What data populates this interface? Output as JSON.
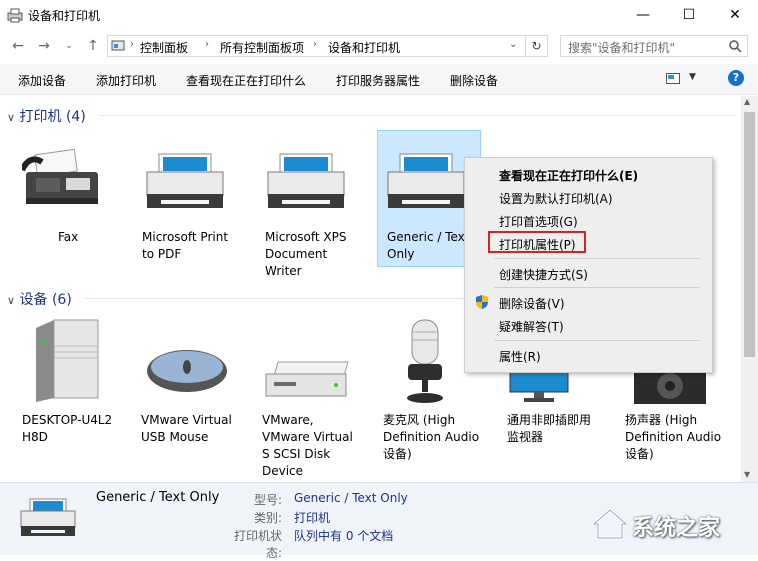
{
  "window": {
    "title": "设备和打印机"
  },
  "address": {
    "crumbs": [
      "控制面板",
      "所有控制面板项",
      "设备和打印机"
    ],
    "search_placeholder": "搜索\"设备和打印机\""
  },
  "toolbar": {
    "items": [
      "添加设备",
      "添加打印机",
      "查看现在正在打印什么",
      "打印服务器属性",
      "删除设备"
    ]
  },
  "printers": {
    "header": "打印机 (4)",
    "items": [
      {
        "lines": [
          "Fax"
        ]
      },
      {
        "lines": [
          "Microsoft Print",
          "to PDF"
        ]
      },
      {
        "lines": [
          "Microsoft XPS",
          "Document",
          "Writer"
        ]
      },
      {
        "lines": [
          "Generic / Tex",
          "Only"
        ]
      }
    ]
  },
  "devices": {
    "header": "设备 (6)",
    "items": [
      {
        "lines": [
          "DESKTOP-U4L2",
          "H8D"
        ]
      },
      {
        "lines": [
          "VMware Virtual",
          "USB Mouse"
        ]
      },
      {
        "lines": [
          "VMware,",
          "VMware Virtual",
          "S SCSI Disk",
          "Device"
        ]
      },
      {
        "lines": [
          "麦克风 (High",
          "Definition Audio",
          "设备)"
        ]
      },
      {
        "lines": [
          "通用非即插即用",
          "监视器"
        ]
      },
      {
        "lines": [
          "扬声器 (High",
          "Definition Audio",
          "设备)"
        ]
      }
    ]
  },
  "context_menu": {
    "items": [
      "查看现在正在打印什么(E)",
      "设置为默认打印机(A)",
      "打印首选项(G)",
      "打印机属性(P)",
      "创建快捷方式(S)",
      "删除设备(V)",
      "疑难解答(T)",
      "属性(R)"
    ]
  },
  "details": {
    "name": "Generic / Text Only",
    "model_key": "型号:",
    "model_val": "Generic / Text Only",
    "cat_key": "类别:",
    "cat_val": "打印机",
    "status_key": "打印机状态:",
    "status_val": "队列中有 0 个文档"
  },
  "watermark": {
    "text": "系统之家"
  },
  "colors": {
    "accent": "#1a6fc9",
    "group_header": "#1e3287",
    "selection": "#cce8ff",
    "highlight_box": "#e02020"
  }
}
